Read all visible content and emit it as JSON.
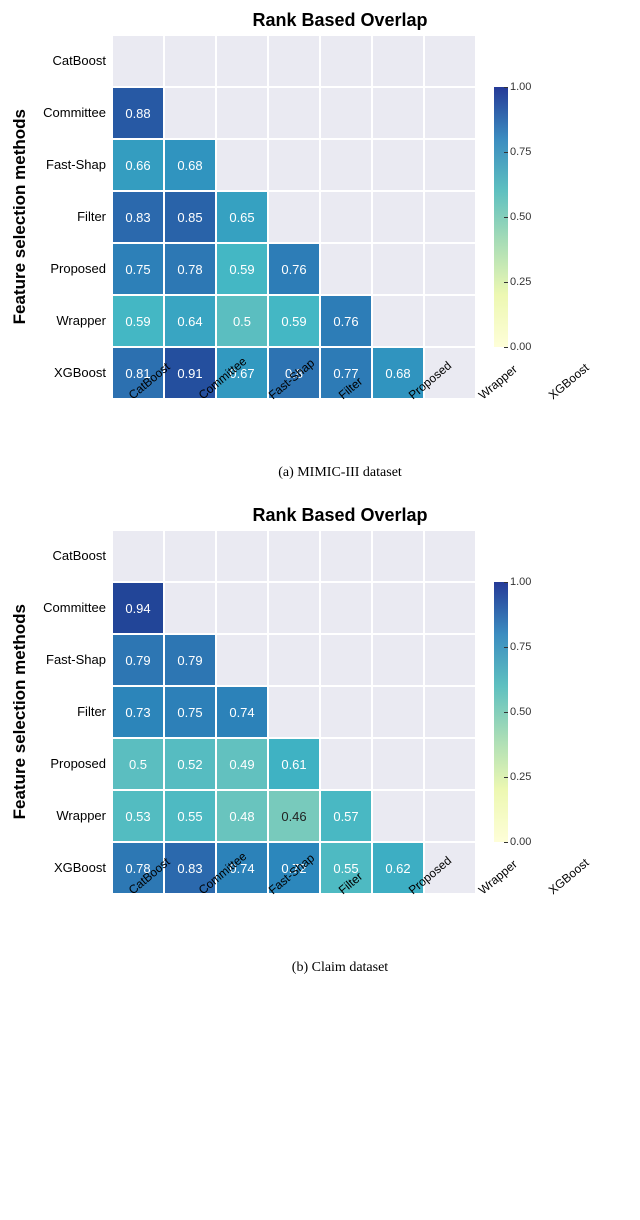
{
  "chart_data": [
    {
      "type": "heatmap",
      "title": "Rank Based Overlap",
      "ylabel": "Feature selection methods",
      "caption": "(a) MIMIC-III dataset",
      "categories": [
        "CatBoost",
        "Committee",
        "Fast-Shap",
        "Filter",
        "Proposed",
        "Wrapper",
        "XGBoost"
      ],
      "colorbar_ticks": [
        "1.00",
        "0.75",
        "0.50",
        "0.25",
        "0.00"
      ],
      "matrix": [
        [
          null,
          null,
          null,
          null,
          null,
          null,
          null
        ],
        [
          0.88,
          null,
          null,
          null,
          null,
          null,
          null
        ],
        [
          0.66,
          0.68,
          null,
          null,
          null,
          null,
          null
        ],
        [
          0.83,
          0.85,
          0.65,
          null,
          null,
          null,
          null
        ],
        [
          0.75,
          0.78,
          0.59,
          0.76,
          null,
          null,
          null
        ],
        [
          0.59,
          0.64,
          0.5,
          0.59,
          0.76,
          null,
          null
        ],
        [
          0.81,
          0.91,
          0.67,
          0.8,
          0.77,
          0.68,
          null
        ]
      ]
    },
    {
      "type": "heatmap",
      "title": "Rank Based Overlap",
      "ylabel": "Feature selection methods",
      "caption": "(b) Claim dataset",
      "categories": [
        "CatBoost",
        "Committee",
        "Fast-Shap",
        "Filter",
        "Proposed",
        "Wrapper",
        "XGBoost"
      ],
      "colorbar_ticks": [
        "1.00",
        "0.75",
        "0.50",
        "0.25",
        "0.00"
      ],
      "matrix": [
        [
          null,
          null,
          null,
          null,
          null,
          null,
          null
        ],
        [
          0.94,
          null,
          null,
          null,
          null,
          null,
          null
        ],
        [
          0.79,
          0.79,
          null,
          null,
          null,
          null,
          null
        ],
        [
          0.73,
          0.75,
          0.74,
          null,
          null,
          null,
          null
        ],
        [
          0.5,
          0.52,
          0.49,
          0.61,
          null,
          null,
          null
        ],
        [
          0.53,
          0.55,
          0.48,
          0.46,
          0.57,
          null,
          null
        ],
        [
          0.78,
          0.83,
          0.74,
          0.72,
          0.55,
          0.62,
          null
        ]
      ]
    }
  ]
}
